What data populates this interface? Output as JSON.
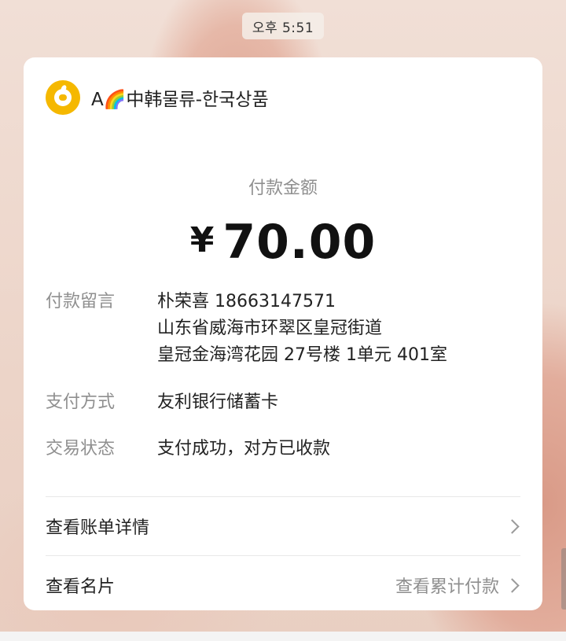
{
  "status_bar": {
    "time": "오후 5:51"
  },
  "merchant": {
    "name": "A🌈中韩물류-한국상품"
  },
  "payment": {
    "amount_label": "付款金额",
    "currency": "¥",
    "amount": "70.00"
  },
  "details": [
    {
      "label": "付款留言",
      "lines": [
        "朴荣喜 18663147571",
        "山东省威海市环翠区皇冠街道",
        "皇冠金海湾花园 27号楼 1单元 401室"
      ]
    },
    {
      "label": "支付方式",
      "lines": [
        "友利银行储蓄卡"
      ]
    },
    {
      "label": "交易状态",
      "lines": [
        "支付成功，对方已收款"
      ]
    }
  ],
  "links": {
    "bill_details": {
      "label": "查看账单详情"
    },
    "business_card": {
      "label": "查看名片",
      "sub_label": "查看累计付款"
    }
  },
  "colors": {
    "merchant_logo": "#f5b800",
    "card_background": "#ffffff",
    "secondary_text": "#8f8f8f",
    "primary_text": "#222222"
  },
  "icons": {
    "merchant_logo": "orange-fruit-logo-icon",
    "chevron": "chevron-right-icon"
  }
}
